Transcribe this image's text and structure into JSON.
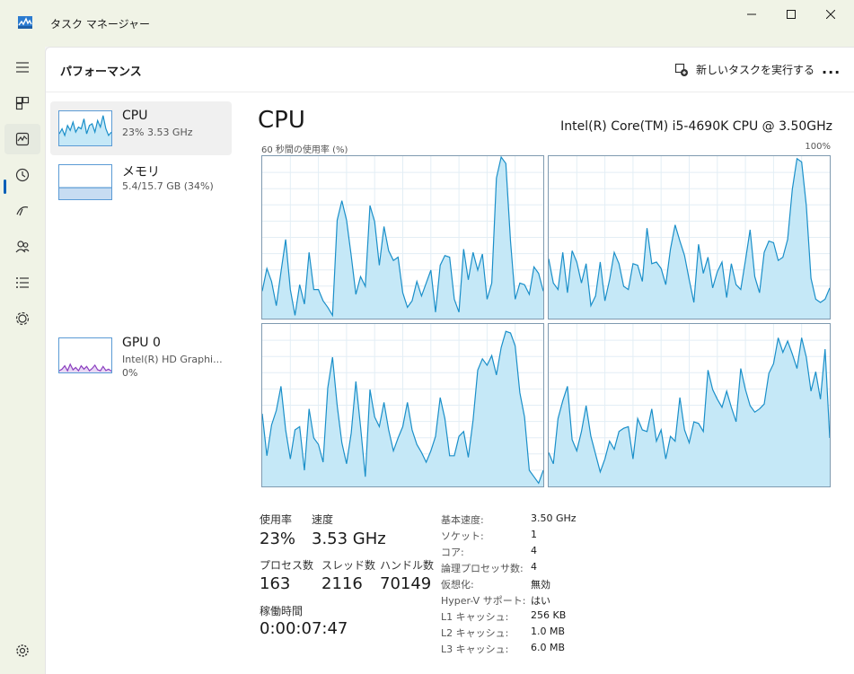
{
  "window": {
    "title": "タスク マネージャー"
  },
  "header": {
    "title": "パフォーマンス",
    "run_new_task": "新しいタスクを実行する",
    "more": "..."
  },
  "rail": {
    "items": [
      "hamburger-menu-icon",
      "processes-icon",
      "performance-icon",
      "app-history-icon",
      "startup-apps-icon",
      "users-icon",
      "details-icon",
      "services-icon"
    ],
    "settings": "gear-icon"
  },
  "devices": [
    {
      "name": "CPU",
      "sub": "23%  3.53 GHz",
      "sub2": ""
    },
    {
      "name": "メモリ",
      "sub": "5.4/15.7 GB (34%)",
      "sub2": ""
    },
    {
      "name": "GPU 0",
      "sub": "Intel(R) HD Graphi...",
      "sub2": "0%"
    }
  ],
  "cpu": {
    "title": "CPU",
    "model": "Intel(R) Core(TM) i5-4690K CPU @ 3.50GHz",
    "graph_label": "60 秒間の使用率 (%)",
    "graph_max": "100%",
    "stats": {
      "utilization_label": "使用率",
      "utilization_value": "23%",
      "speed_label": "速度",
      "speed_value": "3.53 GHz",
      "processes_label": "プロセス数",
      "processes_value": "163",
      "threads_label": "スレッド数",
      "threads_value": "2116",
      "handles_label": "ハンドル数",
      "handles_value": "70149",
      "uptime_label": "稼働時間",
      "uptime_value": "0:00:07:47"
    },
    "specs": [
      {
        "label": "基本速度:",
        "value": "3.50 GHz"
      },
      {
        "label": "ソケット:",
        "value": "1"
      },
      {
        "label": "コア:",
        "value": "4"
      },
      {
        "label": "論理プロセッサ数:",
        "value": "4"
      },
      {
        "label": "仮想化:",
        "value": "無効"
      },
      {
        "label": "Hyper-V サポート:",
        "value": "はい"
      },
      {
        "label": "L1 キャッシュ:",
        "value": "256 KB"
      },
      {
        "label": "L2 キャッシュ:",
        "value": "1.0 MB"
      },
      {
        "label": "L3 キャッシュ:",
        "value": "6.0 MB"
      }
    ]
  },
  "colors": {
    "accent": "#005fb8",
    "graph_fill": "#c5e8f7",
    "graph_line": "#1a8fc9",
    "graph_grid": "#e3eef5",
    "memory_fill": "#c7dcf2",
    "gpu_line": "#8b3fc0"
  },
  "cores": [
    [
      0.17,
      0.31,
      0.23,
      0.08,
      0.29,
      0.49,
      0.18,
      0.02,
      0.21,
      0.09,
      0.41,
      0.18,
      0.18,
      0.11,
      0.07,
      0.02,
      0.61,
      0.73,
      0.61,
      0.39,
      0.15,
      0.26,
      0.2,
      0.7,
      0.6,
      0.33,
      0.57,
      0.42,
      0.36,
      0.38,
      0.16,
      0.07,
      0.11,
      0.23,
      0.14,
      0.22,
      0.3,
      0.04,
      0.33,
      0.39,
      0.38,
      0.12,
      0.04,
      0.43,
      0.24,
      0.41,
      0.3,
      0.4,
      0.12,
      0.22,
      0.87,
      1.0,
      0.96,
      0.48,
      0.12,
      0.22,
      0.21,
      0.15,
      0.32,
      0.28,
      0.17
    ],
    [
      0.37,
      0.22,
      0.18,
      0.41,
      0.16,
      0.42,
      0.35,
      0.22,
      0.34,
      0.08,
      0.14,
      0.35,
      0.11,
      0.24,
      0.41,
      0.34,
      0.2,
      0.18,
      0.34,
      0.33,
      0.23,
      0.56,
      0.34,
      0.35,
      0.31,
      0.21,
      0.43,
      0.58,
      0.48,
      0.39,
      0.24,
      0.1,
      0.46,
      0.28,
      0.38,
      0.19,
      0.29,
      0.35,
      0.13,
      0.34,
      0.21,
      0.18,
      0.36,
      0.55,
      0.26,
      0.16,
      0.41,
      0.48,
      0.47,
      0.36,
      0.38,
      0.49,
      0.8,
      0.99,
      0.97,
      0.7,
      0.25,
      0.12,
      0.1,
      0.12,
      0.19
    ],
    [
      0.45,
      0.19,
      0.38,
      0.47,
      0.62,
      0.35,
      0.17,
      0.35,
      0.37,
      0.1,
      0.48,
      0.3,
      0.26,
      0.15,
      0.61,
      0.8,
      0.5,
      0.27,
      0.14,
      0.33,
      0.65,
      0.37,
      0.06,
      0.6,
      0.43,
      0.37,
      0.52,
      0.35,
      0.22,
      0.3,
      0.37,
      0.52,
      0.35,
      0.26,
      0.21,
      0.15,
      0.22,
      0.31,
      0.55,
      0.42,
      0.19,
      0.19,
      0.31,
      0.34,
      0.18,
      0.41,
      0.72,
      0.79,
      0.75,
      0.81,
      0.69,
      0.86,
      0.96,
      0.95,
      0.87,
      0.58,
      0.43,
      0.1,
      0.06,
      0.02,
      0.1
    ],
    [
      0.21,
      0.14,
      0.42,
      0.53,
      0.62,
      0.29,
      0.22,
      0.34,
      0.5,
      0.31,
      0.2,
      0.09,
      0.17,
      0.28,
      0.23,
      0.34,
      0.36,
      0.37,
      0.17,
      0.42,
      0.35,
      0.34,
      0.48,
      0.28,
      0.35,
      0.17,
      0.31,
      0.28,
      0.55,
      0.35,
      0.27,
      0.4,
      0.39,
      0.34,
      0.72,
      0.6,
      0.54,
      0.49,
      0.59,
      0.49,
      0.4,
      0.73,
      0.6,
      0.5,
      0.46,
      0.48,
      0.51,
      0.7,
      0.76,
      0.92,
      0.83,
      0.9,
      0.82,
      0.73,
      0.92,
      0.8,
      0.59,
      0.71,
      0.54,
      0.85,
      0.3
    ]
  ],
  "mini": {
    "cpu": [
      0.35,
      0.5,
      0.3,
      0.6,
      0.45,
      0.7,
      0.4,
      0.55,
      0.5,
      0.8,
      0.35,
      0.6,
      0.65,
      0.4,
      0.75,
      0.55,
      0.9,
      0.5,
      0.3,
      0.4
    ],
    "memory": 0.34,
    "gpu": [
      0.05,
      0.1,
      0.2,
      0.05,
      0.25,
      0.08,
      0.15,
      0.05,
      0.2,
      0.1,
      0.18,
      0.05,
      0.12,
      0.22,
      0.08,
      0.05,
      0.18,
      0.06,
      0.1,
      0.04
    ]
  }
}
